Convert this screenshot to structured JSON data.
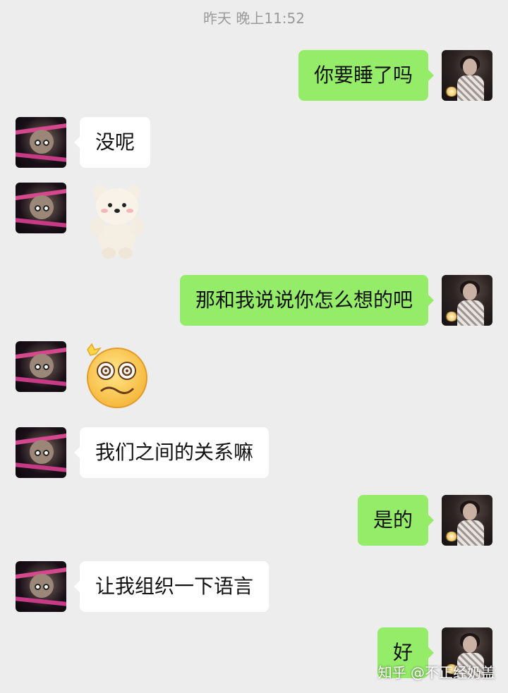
{
  "timestamp": "昨天 晚上11:52",
  "messages": [
    {
      "side": "right",
      "type": "text",
      "text": "你要睡了吗"
    },
    {
      "side": "left",
      "type": "text",
      "text": "没呢"
    },
    {
      "side": "left",
      "type": "sticker",
      "sticker": "bear-sticker"
    },
    {
      "side": "right",
      "type": "text",
      "text": "那和我说说你怎么想的吧"
    },
    {
      "side": "left",
      "type": "sticker",
      "sticker": "dizzy-face-emoji"
    },
    {
      "side": "left",
      "type": "text",
      "text": "我们之间的关系嘛"
    },
    {
      "side": "right",
      "type": "text",
      "text": "是的"
    },
    {
      "side": "left",
      "type": "text",
      "text": "让我组织一下语言"
    },
    {
      "side": "right",
      "type": "text",
      "text": "好"
    }
  ],
  "watermark": "知乎 @不正经奶盖",
  "colors": {
    "background": "#ededed",
    "self_bubble": "#95ec69",
    "other_bubble": "#ffffff",
    "timestamp": "#9a9a9a"
  }
}
